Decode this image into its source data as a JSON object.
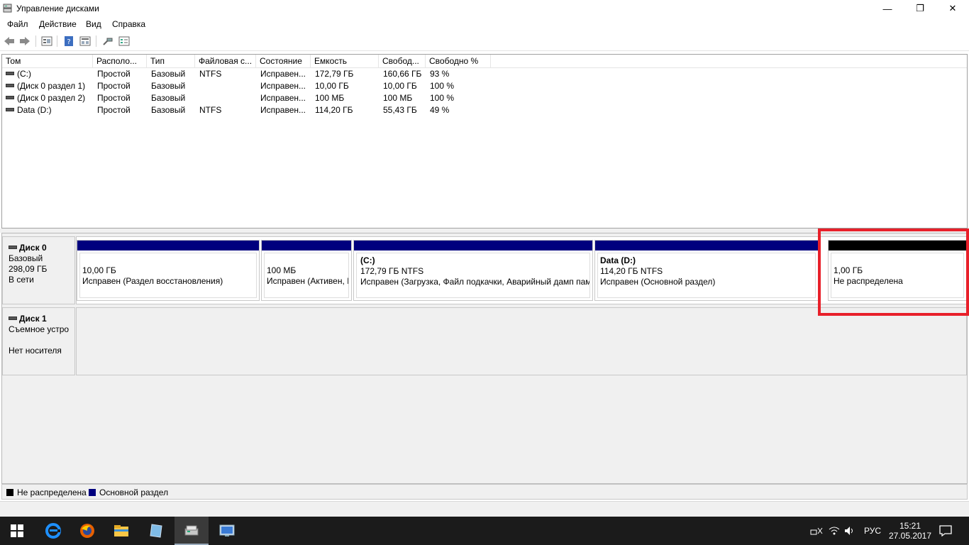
{
  "window": {
    "title": "Управление дисками",
    "controls": {
      "minimize": "—",
      "maximize": "❐",
      "close": "✕"
    }
  },
  "menu": [
    "Файл",
    "Действие",
    "Вид",
    "Справка"
  ],
  "toolbar_icons": [
    "back-icon",
    "forward-icon",
    "properties-icon",
    "help-icon",
    "view-icon",
    "connect-icon",
    "settings-icon"
  ],
  "volume_table": {
    "columns": [
      "Том",
      "Располо...",
      "Тип",
      "Файловая с...",
      "Состояние",
      "Емкость",
      "Свобод...",
      "Свободно %"
    ],
    "rows": [
      [
        "(C:)",
        "Простой",
        "Базовый",
        "NTFS",
        "Исправен...",
        "172,79 ГБ",
        "160,66 ГБ",
        "93 %"
      ],
      [
        "(Диск 0 раздел 1)",
        "Простой",
        "Базовый",
        "",
        "Исправен...",
        "10,00 ГБ",
        "10,00 ГБ",
        "100 %"
      ],
      [
        "(Диск 0 раздел 2)",
        "Простой",
        "Базовый",
        "",
        "Исправен...",
        "100 МБ",
        "100 МБ",
        "100 %"
      ],
      [
        "Data (D:)",
        "Простой",
        "Базовый",
        "NTFS",
        "Исправен...",
        "114,20 ГБ",
        "55,43 ГБ",
        "49 %"
      ]
    ]
  },
  "disks": [
    {
      "name": "Диск 0",
      "type": "Базовый",
      "size": "298,09 ГБ",
      "status": "В сети",
      "partitions": [
        {
          "name": "",
          "size": "10,00 ГБ",
          "status": "Исправен (Раздел восстановления)",
          "color": "#00007e"
        },
        {
          "name": "",
          "size": "100 МБ",
          "status": "Исправен (Активен, I",
          "color": "#00007e"
        },
        {
          "name": "(C:)",
          "size": "172,79 ГБ NTFS",
          "status": "Исправен (Загрузка, Файл подкачки, Аварийный дамп пам",
          "color": "#00007e"
        },
        {
          "name": "Data  (D:)",
          "size": "114,20 ГБ NTFS",
          "status": "Исправен (Основной раздел)",
          "color": "#00007e"
        },
        {
          "name": "",
          "size": "1,00 ГБ",
          "status": "Не распределена",
          "color": "#000000"
        }
      ]
    },
    {
      "name": "Диск 1",
      "type": "Съемное устро",
      "media": "Нет носителя"
    }
  ],
  "legend": [
    {
      "label": "Не распределена",
      "color": "#000000"
    },
    {
      "label": "Основной раздел",
      "color": "#00007e"
    }
  ],
  "taskbar": {
    "apps": [
      "windows-start-icon",
      "edge-icon",
      "firefox-icon",
      "file-explorer-icon",
      "notepad-icon",
      "disk-management-icon",
      "remote-desktop-icon"
    ],
    "language": "РУС",
    "time": "15:21",
    "date": "27.05.2017"
  },
  "highlight_color": "#e8202a"
}
